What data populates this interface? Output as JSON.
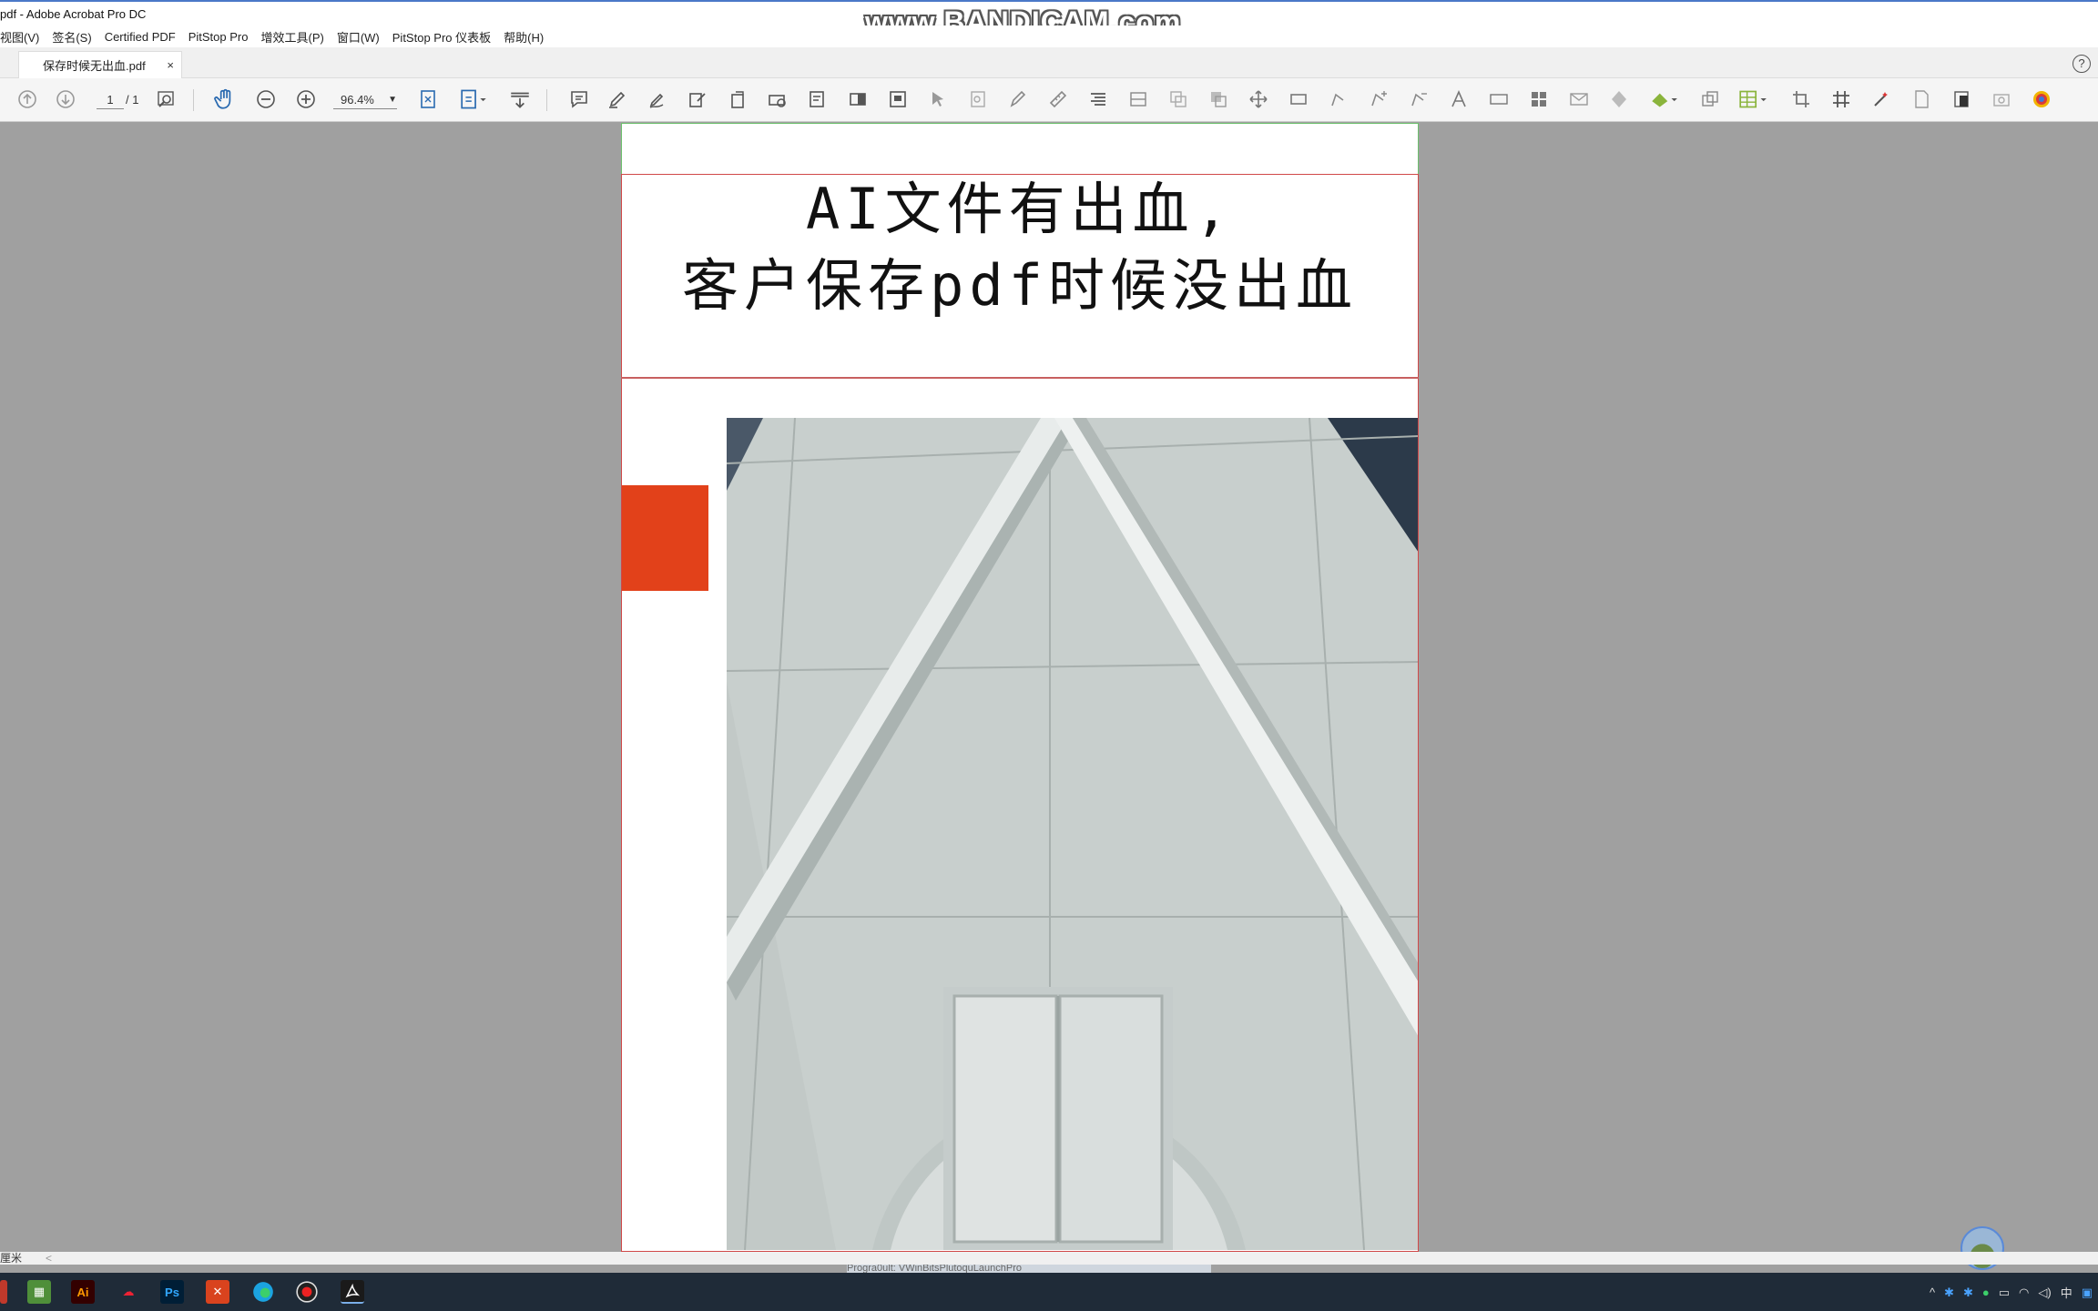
{
  "window": {
    "title": "pdf - Adobe Acrobat Pro DC",
    "watermark": "www.BANDICAM.com"
  },
  "menu": [
    "视图(V)",
    "签名(S)",
    "Certified PDF",
    "PitStop Pro",
    "增效工具(P)",
    "窗口(W)",
    "PitStop Pro 仪表板",
    "帮助(H)"
  ],
  "tab": {
    "label": "保存时候无出血.pdf",
    "close": "×"
  },
  "help": "?",
  "toolbar": {
    "page_current": "1",
    "page_total": "/ 1",
    "zoom": "96.4%"
  },
  "document": {
    "title_line1": "AI文件有出血,",
    "title_line2": "客户保存pdf时候没出血",
    "accent_color": "#e2411a"
  },
  "status": {
    "unit": "厘米",
    "scroll": "<"
  },
  "taskbar": {
    "apps": [
      "Ai",
      "Ps"
    ],
    "tray_ime": "中",
    "ghost_text": "Progra0ult: VWinBitsPlutoquLaunchPro"
  }
}
